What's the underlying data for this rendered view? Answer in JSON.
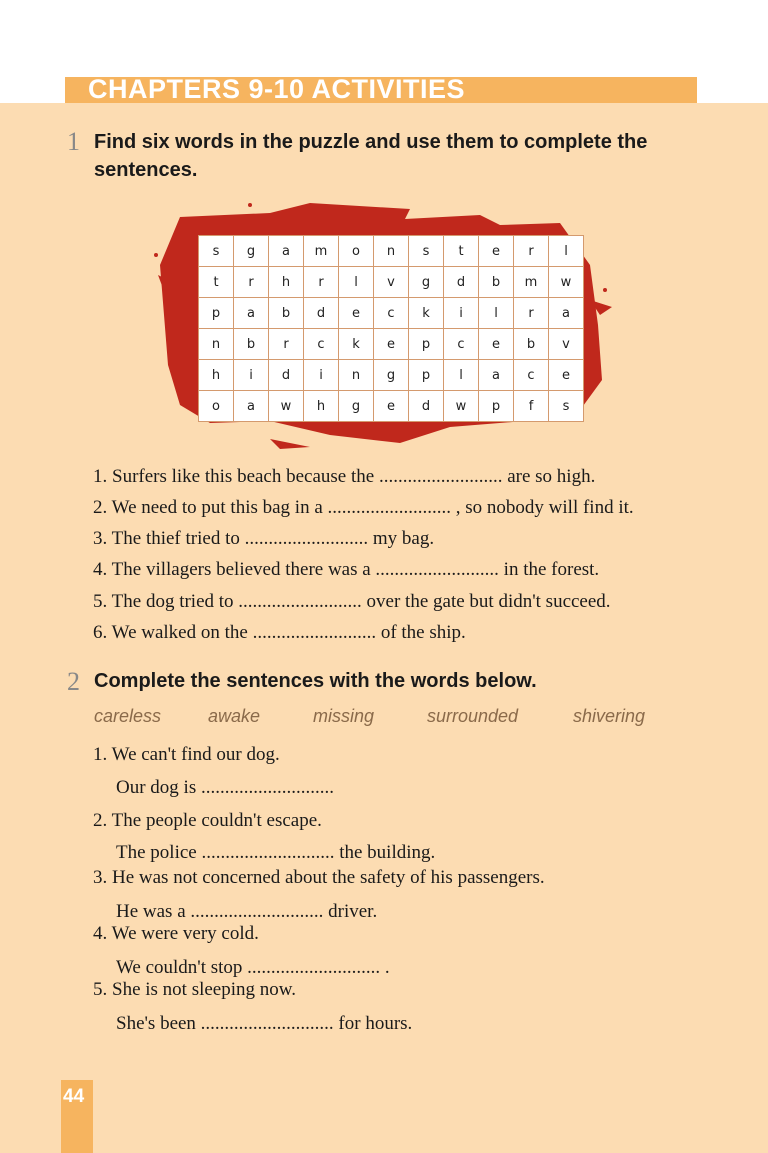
{
  "header": {
    "title": "CHAPTERS 9-10 ACTIVITIES"
  },
  "exercise1": {
    "number": "1",
    "instruction_line1": "Find six words in the puzzle and use them to complete the",
    "instruction_line2": "sentences.",
    "grid": [
      [
        "s",
        "g",
        "a",
        "m",
        "o",
        "n",
        "s",
        "t",
        "e",
        "r",
        "l"
      ],
      [
        "t",
        "r",
        "h",
        "r",
        "l",
        "v",
        "g",
        "d",
        "b",
        "m",
        "w"
      ],
      [
        "p",
        "a",
        "b",
        "d",
        "e",
        "c",
        "k",
        "i",
        "l",
        "r",
        "a"
      ],
      [
        "n",
        "b",
        "r",
        "c",
        "k",
        "e",
        "p",
        "c",
        "e",
        "b",
        "v"
      ],
      [
        "h",
        "i",
        "d",
        "i",
        "n",
        "g",
        "p",
        "l",
        "a",
        "c",
        "e"
      ],
      [
        "o",
        "a",
        "w",
        "h",
        "g",
        "e",
        "d",
        "w",
        "p",
        "f",
        "s"
      ]
    ],
    "sentences": [
      "1. Surfers like this beach because the .......................... are so high.",
      "2. We need to put this bag in a .......................... , so nobody will find it.",
      "3. The thief tried to .......................... my bag.",
      "4. The villagers believed there was a .......................... in the forest.",
      "5. The dog tried to .......................... over the gate but didn't succeed.",
      "6. We walked on the .......................... of the ship."
    ]
  },
  "exercise2": {
    "number": "2",
    "instruction": "Complete the sentences with the words below.",
    "words": [
      "careless",
      "awake",
      "missing",
      "surrounded",
      "shivering"
    ],
    "lines": [
      "1. We can't find our dog.",
      "Our dog is ............................",
      "2. The people couldn't escape.",
      "The police ............................ the building.",
      "3. He was not concerned about the safety of his passengers.",
      "He was a ............................ driver.",
      "4. We were very cold.",
      "We couldn't stop ............................ .",
      "5. She is not sleeping now.",
      "She's been ............................ for hours."
    ]
  },
  "footer": {
    "page_number": "44"
  },
  "colors": {
    "background": "#fcdcb2",
    "accent": "#f6b45f",
    "splash": "#c0281c"
  }
}
